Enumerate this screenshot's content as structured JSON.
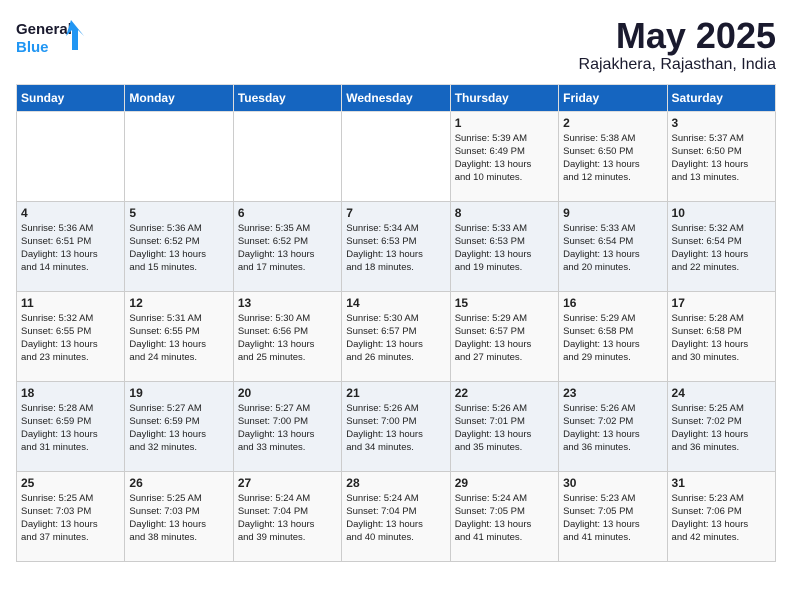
{
  "logo": {
    "line1": "General",
    "line2": "Blue"
  },
  "title": "May 2025",
  "subtitle": "Rajakhera, Rajasthan, India",
  "days_of_week": [
    "Sunday",
    "Monday",
    "Tuesday",
    "Wednesday",
    "Thursday",
    "Friday",
    "Saturday"
  ],
  "weeks": [
    [
      {
        "day": "",
        "info": ""
      },
      {
        "day": "",
        "info": ""
      },
      {
        "day": "",
        "info": ""
      },
      {
        "day": "",
        "info": ""
      },
      {
        "day": "1",
        "info": "Sunrise: 5:39 AM\nSunset: 6:49 PM\nDaylight: 13 hours\nand 10 minutes."
      },
      {
        "day": "2",
        "info": "Sunrise: 5:38 AM\nSunset: 6:50 PM\nDaylight: 13 hours\nand 12 minutes."
      },
      {
        "day": "3",
        "info": "Sunrise: 5:37 AM\nSunset: 6:50 PM\nDaylight: 13 hours\nand 13 minutes."
      }
    ],
    [
      {
        "day": "4",
        "info": "Sunrise: 5:36 AM\nSunset: 6:51 PM\nDaylight: 13 hours\nand 14 minutes."
      },
      {
        "day": "5",
        "info": "Sunrise: 5:36 AM\nSunset: 6:52 PM\nDaylight: 13 hours\nand 15 minutes."
      },
      {
        "day": "6",
        "info": "Sunrise: 5:35 AM\nSunset: 6:52 PM\nDaylight: 13 hours\nand 17 minutes."
      },
      {
        "day": "7",
        "info": "Sunrise: 5:34 AM\nSunset: 6:53 PM\nDaylight: 13 hours\nand 18 minutes."
      },
      {
        "day": "8",
        "info": "Sunrise: 5:33 AM\nSunset: 6:53 PM\nDaylight: 13 hours\nand 19 minutes."
      },
      {
        "day": "9",
        "info": "Sunrise: 5:33 AM\nSunset: 6:54 PM\nDaylight: 13 hours\nand 20 minutes."
      },
      {
        "day": "10",
        "info": "Sunrise: 5:32 AM\nSunset: 6:54 PM\nDaylight: 13 hours\nand 22 minutes."
      }
    ],
    [
      {
        "day": "11",
        "info": "Sunrise: 5:32 AM\nSunset: 6:55 PM\nDaylight: 13 hours\nand 23 minutes."
      },
      {
        "day": "12",
        "info": "Sunrise: 5:31 AM\nSunset: 6:55 PM\nDaylight: 13 hours\nand 24 minutes."
      },
      {
        "day": "13",
        "info": "Sunrise: 5:30 AM\nSunset: 6:56 PM\nDaylight: 13 hours\nand 25 minutes."
      },
      {
        "day": "14",
        "info": "Sunrise: 5:30 AM\nSunset: 6:57 PM\nDaylight: 13 hours\nand 26 minutes."
      },
      {
        "day": "15",
        "info": "Sunrise: 5:29 AM\nSunset: 6:57 PM\nDaylight: 13 hours\nand 27 minutes."
      },
      {
        "day": "16",
        "info": "Sunrise: 5:29 AM\nSunset: 6:58 PM\nDaylight: 13 hours\nand 29 minutes."
      },
      {
        "day": "17",
        "info": "Sunrise: 5:28 AM\nSunset: 6:58 PM\nDaylight: 13 hours\nand 30 minutes."
      }
    ],
    [
      {
        "day": "18",
        "info": "Sunrise: 5:28 AM\nSunset: 6:59 PM\nDaylight: 13 hours\nand 31 minutes."
      },
      {
        "day": "19",
        "info": "Sunrise: 5:27 AM\nSunset: 6:59 PM\nDaylight: 13 hours\nand 32 minutes."
      },
      {
        "day": "20",
        "info": "Sunrise: 5:27 AM\nSunset: 7:00 PM\nDaylight: 13 hours\nand 33 minutes."
      },
      {
        "day": "21",
        "info": "Sunrise: 5:26 AM\nSunset: 7:00 PM\nDaylight: 13 hours\nand 34 minutes."
      },
      {
        "day": "22",
        "info": "Sunrise: 5:26 AM\nSunset: 7:01 PM\nDaylight: 13 hours\nand 35 minutes."
      },
      {
        "day": "23",
        "info": "Sunrise: 5:26 AM\nSunset: 7:02 PM\nDaylight: 13 hours\nand 36 minutes."
      },
      {
        "day": "24",
        "info": "Sunrise: 5:25 AM\nSunset: 7:02 PM\nDaylight: 13 hours\nand 36 minutes."
      }
    ],
    [
      {
        "day": "25",
        "info": "Sunrise: 5:25 AM\nSunset: 7:03 PM\nDaylight: 13 hours\nand 37 minutes."
      },
      {
        "day": "26",
        "info": "Sunrise: 5:25 AM\nSunset: 7:03 PM\nDaylight: 13 hours\nand 38 minutes."
      },
      {
        "day": "27",
        "info": "Sunrise: 5:24 AM\nSunset: 7:04 PM\nDaylight: 13 hours\nand 39 minutes."
      },
      {
        "day": "28",
        "info": "Sunrise: 5:24 AM\nSunset: 7:04 PM\nDaylight: 13 hours\nand 40 minutes."
      },
      {
        "day": "29",
        "info": "Sunrise: 5:24 AM\nSunset: 7:05 PM\nDaylight: 13 hours\nand 41 minutes."
      },
      {
        "day": "30",
        "info": "Sunrise: 5:23 AM\nSunset: 7:05 PM\nDaylight: 13 hours\nand 41 minutes."
      },
      {
        "day": "31",
        "info": "Sunrise: 5:23 AM\nSunset: 7:06 PM\nDaylight: 13 hours\nand 42 minutes."
      }
    ]
  ]
}
